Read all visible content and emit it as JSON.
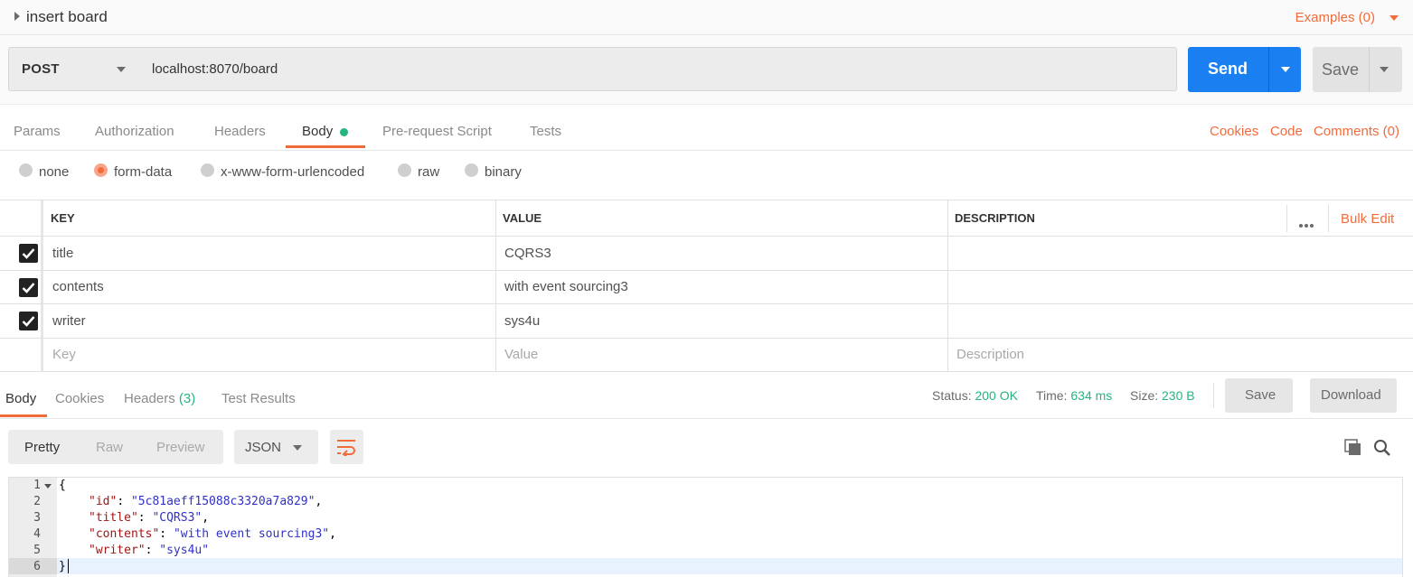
{
  "request": {
    "name": "insert board",
    "examples_label": "Examples (0)",
    "method": "POST",
    "url": "localhost:8070/board",
    "send_label": "Send",
    "save_label": "Save"
  },
  "request_tabs": [
    "Params",
    "Authorization",
    "Headers",
    "Body",
    "Pre-request Script",
    "Tests"
  ],
  "request_links": [
    "Cookies",
    "Code",
    "Comments (0)"
  ],
  "body_types": [
    "none",
    "form-data",
    "x-www-form-urlencoded",
    "raw",
    "binary"
  ],
  "body_type_selected": "form-data",
  "form": {
    "headers": {
      "key": "KEY",
      "value": "VALUE",
      "description": "DESCRIPTION"
    },
    "bulk_edit": "Bulk Edit",
    "rows": [
      {
        "key": "title",
        "value": "CQRS3"
      },
      {
        "key": "contents",
        "value": "with event sourcing3"
      },
      {
        "key": "writer",
        "value": "sys4u"
      }
    ],
    "placeholders": {
      "key": "Key",
      "value": "Value",
      "description": "Description"
    }
  },
  "response": {
    "tabs": {
      "body": "Body",
      "cookies": "Cookies",
      "headers": "Headers",
      "headers_count": "(3)",
      "tests": "Test Results"
    },
    "status_label": "Status:",
    "status": "200 OK",
    "time_label": "Time:",
    "time": "634 ms",
    "size_label": "Size:",
    "size": "230 B",
    "save_label": "Save",
    "download_label": "Download",
    "views": [
      "Pretty",
      "Raw",
      "Preview"
    ],
    "format": "JSON"
  },
  "response_body": {
    "line_numbers": [
      "1",
      "2",
      "3",
      "4",
      "5",
      "6"
    ],
    "open_brace": "{",
    "close_brace": "}",
    "fields": [
      {
        "key": "\"id\"",
        "value": "\"5c81aeff15088c3320a7a829\"",
        "trail": ","
      },
      {
        "key": "\"title\"",
        "value": "\"CQRS3\"",
        "trail": ","
      },
      {
        "key": "\"contents\"",
        "value": "\"with event sourcing3\"",
        "trail": ","
      },
      {
        "key": "\"writer\"",
        "value": "\"sys4u\"",
        "trail": ""
      }
    ]
  },
  "colors": {
    "accent": "#f26b3a",
    "send_blue": "#1a7ff0",
    "status_green": "#26b47f"
  }
}
